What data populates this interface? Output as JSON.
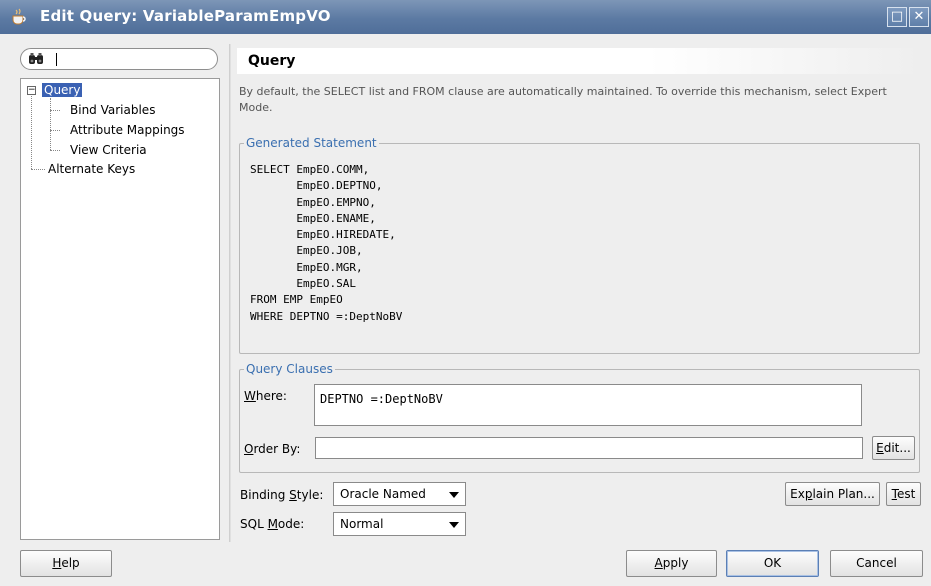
{
  "window": {
    "title": "Edit Query: VariableParamEmpVO",
    "maximize_glyph": "□",
    "close_glyph": "✕"
  },
  "search": {
    "value": "",
    "icon": "binoculars-icon"
  },
  "tree": {
    "items": [
      {
        "label": "Query",
        "selected": true,
        "expanded": true
      },
      {
        "label": "Bind Variables"
      },
      {
        "label": "Attribute Mappings"
      },
      {
        "label": "View Criteria"
      },
      {
        "label": "Alternate Keys"
      }
    ],
    "expander_glyph": "−"
  },
  "header": {
    "title": "Query"
  },
  "description": "By default, the SELECT list and FROM clause are automatically maintained.  To override this mechanism, select Expert Mode.",
  "generated_statement": {
    "legend": "Generated Statement",
    "sql": "SELECT EmpEO.COMM,\n       EmpEO.DEPTNO,\n       EmpEO.EMPNO,\n       EmpEO.ENAME,\n       EmpEO.HIREDATE,\n       EmpEO.JOB,\n       EmpEO.MGR,\n       EmpEO.SAL\nFROM EMP EmpEO\nWHERE DEPTNO =:DeptNoBV"
  },
  "query_clauses": {
    "legend": "Query Clauses",
    "where_label": "Where:",
    "where_value": "DEPTNO =:DeptNoBV",
    "orderby_label": "Order By:",
    "orderby_value": "",
    "edit_button": "Edit..."
  },
  "options": {
    "binding_style_label": "Binding Style:",
    "binding_style_value": "Oracle Named",
    "sql_mode_label": "SQL Mode:",
    "sql_mode_value": "Normal",
    "explain_plan_button": "Explain Plan...",
    "test_button": "Test"
  },
  "footer": {
    "help": "Help",
    "apply": "Apply",
    "ok": "OK",
    "cancel": "Cancel"
  },
  "colors": {
    "titlebar": "#5c7aa3",
    "legend_text": "#3a6fb0",
    "selection": "#3a61b3",
    "dialog_bg": "#eeeeee"
  }
}
